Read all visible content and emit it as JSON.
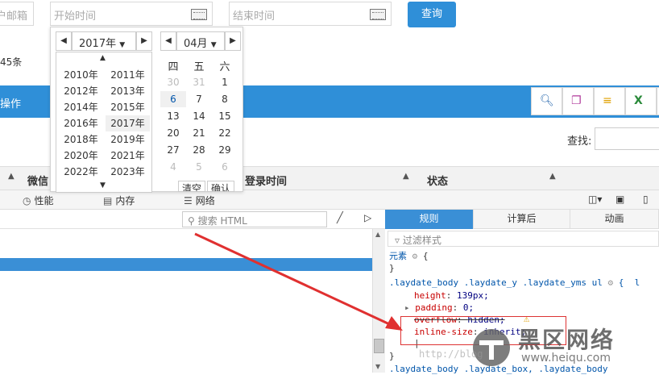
{
  "filters": {
    "email_placeholder": "户邮箱",
    "start_placeholder": "开始时间",
    "end_placeholder": "结束时间",
    "query_button": "查询"
  },
  "record_count": "45条",
  "toolbar": {
    "operate_label": "操作",
    "search_label": "查找:"
  },
  "table": {
    "headers": [
      "微信",
      "登录时间",
      "状态"
    ]
  },
  "calendar": {
    "year_select": "2017年",
    "month_select": "04月",
    "years": [
      "2010年",
      "2011年",
      "2012年",
      "2013年",
      "2014年",
      "2015年",
      "2016年",
      "2017年",
      "2018年",
      "2019年",
      "2020年",
      "2021年",
      "2022年",
      "2023年"
    ],
    "current_year": "2017年",
    "weekdays": [
      "四",
      "五",
      "六"
    ],
    "rows": [
      [
        "30",
        "31",
        "1"
      ],
      [
        "6",
        "7",
        "8"
      ],
      [
        "13",
        "14",
        "15"
      ],
      [
        "20",
        "21",
        "22"
      ],
      [
        "27",
        "28",
        "29"
      ],
      [
        "4",
        "5",
        "6"
      ]
    ],
    "clear_button": "清空",
    "confirm_button": "确认"
  },
  "devtools": {
    "tabs": [
      "性能",
      "内存",
      "网络"
    ],
    "search_html_placeholder": "搜索 HTML",
    "rules_tabs": [
      "规则",
      "计算后",
      "动画"
    ],
    "filter_placeholder": "过滤样式",
    "element_label": "元素",
    "rule_selector": ".laydate_body .laydate_y .laydate_yms ul",
    "rule_selector_2": ".laydate_body .laydate_box, .laydate_body",
    "rule_suffix": "l",
    "props": [
      {
        "name": "height",
        "value": "139px;"
      },
      {
        "name": "padding",
        "value": "0;"
      },
      {
        "name": "overflow",
        "value": "hidden;"
      },
      {
        "name": "inline-size",
        "value": "inherit;"
      }
    ]
  },
  "watermark": {
    "text": "黑区网络",
    "url": "www.heiqu.com",
    "blog_text": "http://blog"
  },
  "colors": {
    "accent": "#2f8fd8",
    "selected": "#3a8fd6",
    "annotation": "#e03030"
  }
}
